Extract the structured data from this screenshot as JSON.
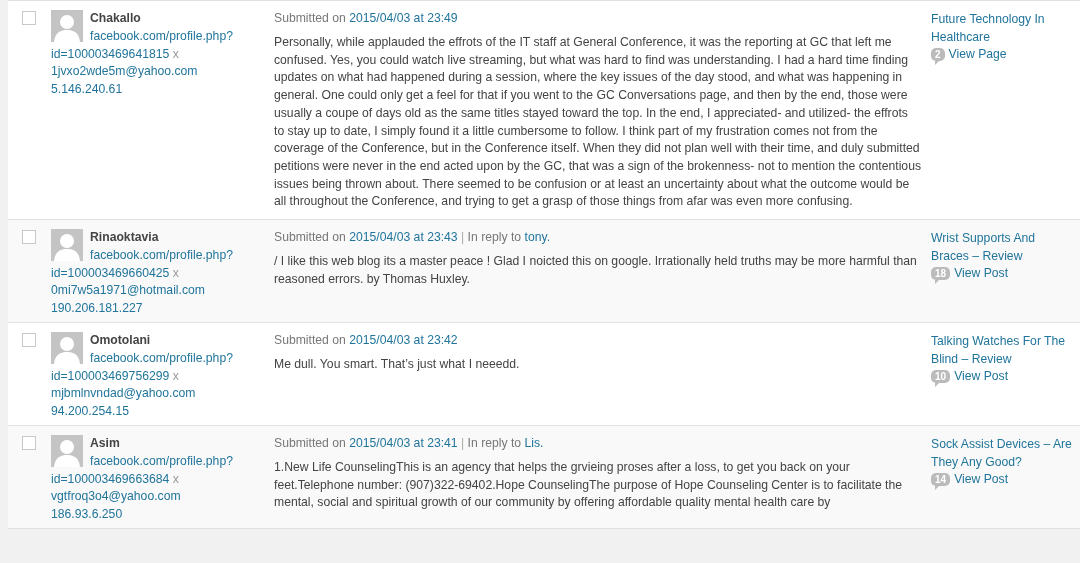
{
  "comments": [
    {
      "selected": false,
      "author": "Chakallo",
      "url": [
        "facebook.com/profile.php?",
        "id=100003469641815"
      ],
      "remove": "x",
      "email": "1jvxo2wde5m@yahoo.com",
      "ip": "5.146.240.61",
      "submitted_label": "Submitted on",
      "date": "2015/04/03 at 23:49",
      "text": "Personally, while applauded the effrots of the IT staff at General Conference, it was the reporting at GC that left me confused. Yes, you could watch live streaming, but what was hard to find was understanding. I had a hard time finding updates on what had happened during a session, where the key issues of the day stood, and what was happening in general. One could only get a feel for that if you went to the GC Conversations page, and then by the end, those were usually a coupe of days old as the same titles stayed toward the top. In the end, I appreciated- and utilized- the effrots to stay up to date, I simply found it a little cumbersome to follow. I think part of my frustration comes not from the coverage of the Conference, but in the Conference itself. When they did not plan well with their time, and duly submitted petitions were never in the end acted upon by the GC, that was a sign of the brokenness- not to mention the contentious issues being thrown about. There seemed to be confusion or at least an uncertainty about what the outcome would be all throughout the Conference, and trying to get a grasp of those things from afar was even more confusing.",
      "post_title": "Future Technology In Healthcare",
      "count": "2",
      "view": "View Page"
    },
    {
      "selected": false,
      "author": "Rinaoktavia",
      "url": [
        "facebook.com/profile.php?",
        "id=100003469660425"
      ],
      "remove": "x",
      "email": "0mi7w5a1971@hotmail.com",
      "ip": "190.206.181.227",
      "submitted_label": "Submitted on",
      "date": "2015/04/03 at 23:43",
      "separator": "|",
      "reply_label": "In reply to",
      "reply_to": "tony.",
      "text": "/ I like this web blog its a master peace ! Glad I noicted this on google. Irrationally held truths may be more harmful than reasoned errors. by Thomas Huxley.",
      "post_title": "Wrist Supports And Braces – Review",
      "count": "18",
      "view": "View Post"
    },
    {
      "selected": false,
      "author": "Omotolani",
      "url": [
        "facebook.com/profile.php?",
        "id=100003469756299"
      ],
      "remove": "x",
      "email": "mjbmlnvndad@yahoo.com",
      "ip": "94.200.254.15",
      "submitted_label": "Submitted on",
      "date": "2015/04/03 at 23:42",
      "text": "Me dull. You smart. That’s just what I neeedd.",
      "post_title": "Talking Watches For The Blind – Review",
      "count": "10",
      "view": "View Post"
    },
    {
      "selected": false,
      "author": "Asim",
      "url": [
        "facebook.com/profile.php?",
        "id=100003469663684"
      ],
      "remove": "x",
      "email": "vgtfroq3o4@yahoo.com",
      "ip": "186.93.6.250",
      "submitted_label": "Submitted on",
      "date": "2015/04/03 at 23:41",
      "separator": "|",
      "reply_label": "In reply to",
      "reply_to": "Lis.",
      "text": "1.New Life CounselingThis is an agency that helps the grvieing proses after a loss, to get you back on your feet.Telephone number: (907)322-69402.Hope CounselingThe purpose of Hope Counseling Center is to facilitate the mental, social and spiritual growth of our community by offering affordable quality mental health care by",
      "post_title": "Sock Assist Devices – Are They Any Good?",
      "count": "14",
      "view": "View Post"
    }
  ]
}
